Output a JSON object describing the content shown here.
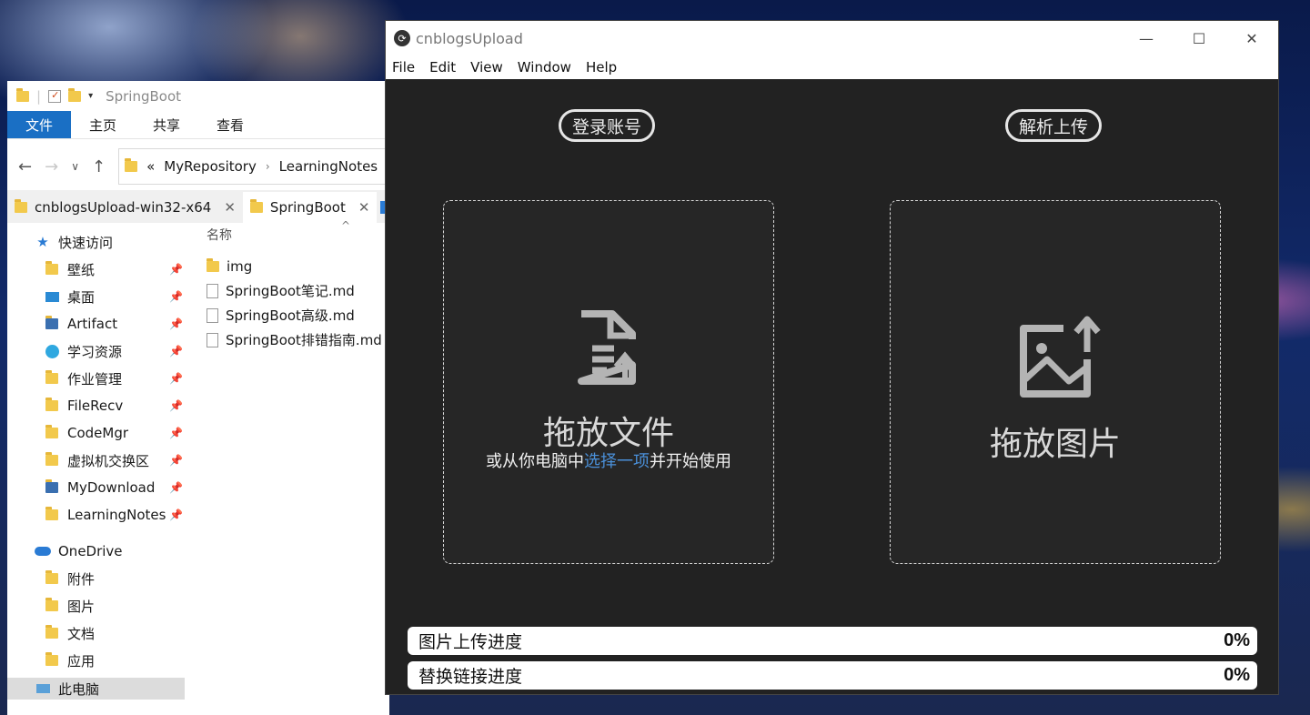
{
  "explorer": {
    "title": "SpringBoot",
    "ribbon_tabs": [
      "文件",
      "主页",
      "共享",
      "查看"
    ],
    "breadcrumb": {
      "prefix": "«",
      "items": [
        "MyRepository",
        "LearningNotes"
      ]
    },
    "tabs": [
      {
        "label": "cnblogsUpload-win32-x64"
      },
      {
        "label": "SpringBoot"
      }
    ],
    "nav": {
      "quick_access": "快速访问",
      "quick_items": [
        "壁纸",
        "桌面",
        "Artifact",
        "学习资源",
        "作业管理",
        "FileRecv",
        "CodeMgr",
        "虚拟机交换区",
        "MyDownload",
        "LearningNotes"
      ],
      "onedrive": "OneDrive",
      "onedrive_items": [
        "附件",
        "图片",
        "文档",
        "应用"
      ],
      "this_pc": "此电脑"
    },
    "column_name": "名称",
    "files": [
      "img",
      "SpringBoot笔记.md",
      "SpringBoot高级.md",
      "SpringBoot排错指南.md"
    ]
  },
  "app": {
    "title": "cnblogsUpload",
    "menu": [
      "File",
      "Edit",
      "View",
      "Window",
      "Help"
    ],
    "login_button": "登录账号",
    "parse_button": "解析上传",
    "file_drop": {
      "title": "拖放文件",
      "sub_before": "或从你电脑中",
      "sub_link": "选择一项",
      "sub_after": "并开始使用"
    },
    "image_drop": {
      "title": "拖放图片"
    },
    "progress_image": {
      "label": "图片上传进度",
      "value": "0%"
    },
    "progress_link": {
      "label": "替换链接进度",
      "value": "0%"
    },
    "colors": {
      "link": "#4a90d9",
      "app_bg": "#222222"
    }
  }
}
